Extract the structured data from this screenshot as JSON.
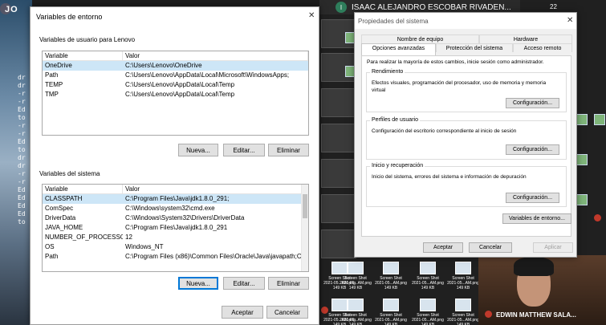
{
  "background": {
    "left_title": "JO",
    "terminal_lines": [
      "dr",
      "dr",
      "-r",
      "-r",
      "Ed",
      "to",
      "-r",
      "-r",
      "Ed",
      "to",
      "dr",
      "dr",
      "-r",
      "-r",
      "Ed",
      "Ed",
      "Ed",
      "Ed",
      "to"
    ]
  },
  "call": {
    "participant_initial": "I",
    "participant_name": "ISAAC ALEJANDRO ESCOBAR RIVADEN...",
    "count": "22",
    "screenshot_label": "Screen Shot",
    "screenshot_date": "2021-05...AM.png",
    "screenshot_size": "149 KB",
    "person_name": "EDWIN MATTHEW SALA..."
  },
  "env_dialog": {
    "title": "Variables de entorno",
    "user_group_label": "Variables de usuario para Lenovo",
    "user_columns": [
      "Variable",
      "Valor"
    ],
    "user_vars": [
      {
        "name": "OneDrive",
        "value": "C:\\Users\\Lenovo\\OneDrive"
      },
      {
        "name": "Path",
        "value": "C:\\Users\\Lenovo\\AppData\\Local\\Microsoft\\WindowsApps;"
      },
      {
        "name": "TEMP",
        "value": "C:\\Users\\Lenovo\\AppData\\Local\\Temp"
      },
      {
        "name": "TMP",
        "value": "C:\\Users\\Lenovo\\AppData\\Local\\Temp"
      }
    ],
    "user_buttons": {
      "new": "Nueva...",
      "edit": "Editar...",
      "delete": "Eliminar"
    },
    "system_group_label": "Variables del sistema",
    "system_columns": [
      "Variable",
      "Valor"
    ],
    "system_vars": [
      {
        "name": "CLASSPATH",
        "value": "C:\\Program Files\\Java\\jdk1.8.0_291;"
      },
      {
        "name": "ComSpec",
        "value": "C:\\Windows\\system32\\cmd.exe"
      },
      {
        "name": "DriverData",
        "value": "C:\\Windows\\System32\\Drivers\\DriverData"
      },
      {
        "name": "JAVA_HOME",
        "value": "C:\\Program Files\\Java\\jdk1.8.0_291"
      },
      {
        "name": "NUMBER_OF_PROCESSORS",
        "value": "12"
      },
      {
        "name": "OS",
        "value": "Windows_NT"
      },
      {
        "name": "Path",
        "value": "C:\\Program Files (x86)\\Common Files\\Oracle\\Java\\javapath;C..."
      }
    ],
    "system_buttons": {
      "new": "Nueva...",
      "edit": "Editar...",
      "delete": "Eliminar"
    },
    "ok": "Aceptar",
    "cancel": "Cancelar"
  },
  "props_dialog": {
    "title": "Propiedades del sistema",
    "tabs_top": [
      "Nombre de equipo",
      "Hardware"
    ],
    "tabs_bottom": [
      "Opciones avanzadas",
      "Protección del sistema",
      "Acceso remoto"
    ],
    "intro": "Para realizar la mayoría de estos cambios, inicie sesión como administrador.",
    "performance": {
      "label": "Rendimiento",
      "text": "Efectos visuales, programación del procesador, uso de memoria y memoria virtual",
      "button": "Configuración..."
    },
    "profiles": {
      "label": "Perfiles de usuario",
      "text": "Configuración del escritorio correspondiente al inicio de sesión",
      "button": "Configuración..."
    },
    "startup": {
      "label": "Inicio y recuperación",
      "text": "Inicio del sistema, errores del sistema e información de depuración",
      "button": "Configuración..."
    },
    "env_button": "Variables de entorno...",
    "ok": "Aceptar",
    "cancel": "Cancelar",
    "apply": "Aplicar"
  }
}
